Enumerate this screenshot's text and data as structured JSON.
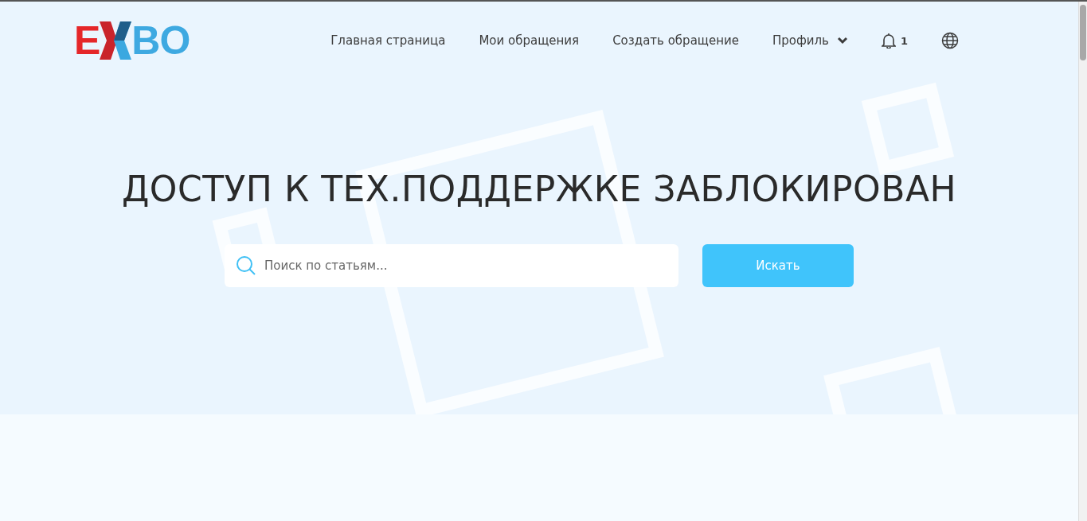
{
  "logo": {
    "left": "E",
    "right": "BO"
  },
  "nav": [
    {
      "label": "Главная страница",
      "kind": "link"
    },
    {
      "label": "Мои обращения",
      "kind": "link"
    },
    {
      "label": "Создать обращение",
      "kind": "link"
    },
    {
      "label": "Профиль",
      "kind": "dropdown"
    }
  ],
  "notifications": {
    "count": "1"
  },
  "hero": {
    "title": "ДОСТУП К ТЕХ.ПОДДЕРЖКЕ ЗАБЛОКИРОВАН",
    "search": {
      "placeholder": "Поиск по статьям..."
    },
    "button": "Искать"
  }
}
